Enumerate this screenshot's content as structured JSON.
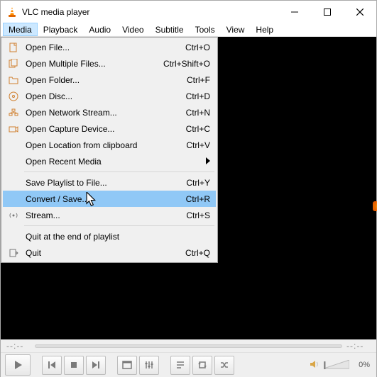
{
  "window": {
    "title": "VLC media player"
  },
  "menubar": {
    "items": [
      {
        "label": "Media",
        "open": true
      },
      {
        "label": "Playback"
      },
      {
        "label": "Audio"
      },
      {
        "label": "Video"
      },
      {
        "label": "Subtitle"
      },
      {
        "label": "Tools"
      },
      {
        "label": "View"
      },
      {
        "label": "Help"
      }
    ]
  },
  "media_menu": {
    "items": [
      {
        "icon": "file",
        "label": "Open File...",
        "shortcut": "Ctrl+O"
      },
      {
        "icon": "files",
        "label": "Open Multiple Files...",
        "shortcut": "Ctrl+Shift+O"
      },
      {
        "icon": "folder",
        "label": "Open Folder...",
        "shortcut": "Ctrl+F"
      },
      {
        "icon": "disc",
        "label": "Open Disc...",
        "shortcut": "Ctrl+D"
      },
      {
        "icon": "network",
        "label": "Open Network Stream...",
        "shortcut": "Ctrl+N"
      },
      {
        "icon": "capture",
        "label": "Open Capture Device...",
        "shortcut": "Ctrl+C"
      },
      {
        "icon": "",
        "label": "Open Location from clipboard",
        "shortcut": "Ctrl+V"
      },
      {
        "icon": "",
        "label": "Open Recent Media",
        "shortcut": "",
        "submenu": true
      },
      {
        "sep": true
      },
      {
        "icon": "",
        "label": "Save Playlist to File...",
        "shortcut": "Ctrl+Y"
      },
      {
        "icon": "",
        "label": "Convert / Save...",
        "shortcut": "Ctrl+R",
        "hover": true
      },
      {
        "icon": "stream",
        "label": "Stream...",
        "shortcut": "Ctrl+S"
      },
      {
        "sep": true
      },
      {
        "icon": "",
        "label": "Quit at the end of playlist",
        "shortcut": ""
      },
      {
        "icon": "quit",
        "label": "Quit",
        "shortcut": "Ctrl+Q"
      }
    ]
  },
  "status": {
    "seek_placeholder": "--:--",
    "volume_pct": "0%"
  },
  "icons": {
    "minimize": "minimize-icon",
    "maximize": "maximize-icon",
    "close": "close-icon"
  }
}
